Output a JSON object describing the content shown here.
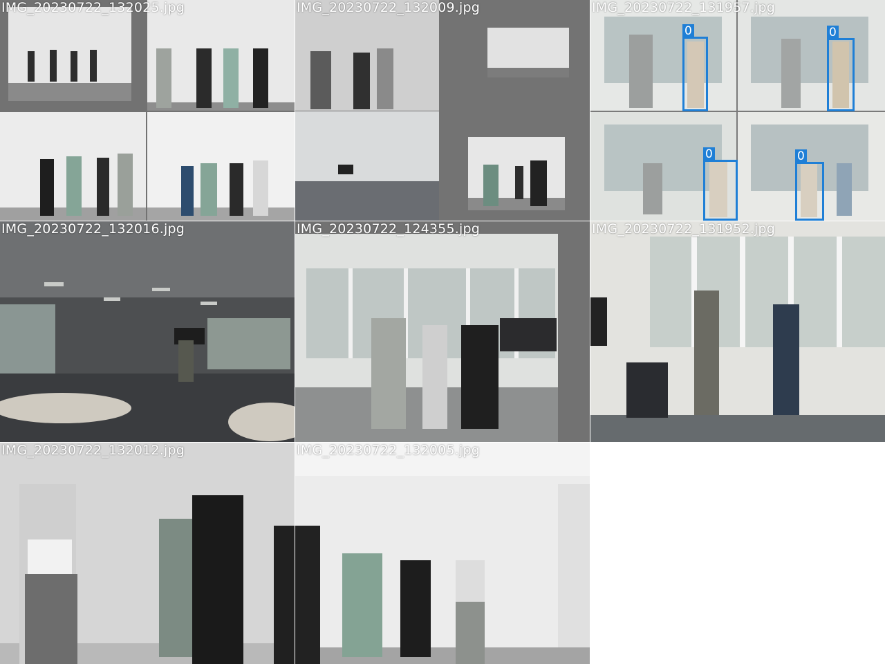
{
  "mosaic": {
    "tiles": [
      {
        "filename": "IMG_20230722_132025.jpg"
      },
      {
        "filename": "IMG_20230722_132009.jpg"
      },
      {
        "filename": "IMG_20230722_131957.jpg"
      },
      {
        "filename": "IMG_20230722_132016.jpg"
      },
      {
        "filename": "IMG_20230722_124355.jpg"
      },
      {
        "filename": "IMG_20230722_131952.jpg"
      },
      {
        "filename": "IMG_20230722_132012.jpg"
      },
      {
        "filename": "IMG_20230722_132005.jpg"
      }
    ],
    "detection_class_label": "0"
  },
  "colors": {
    "padding_gray": "#727272",
    "bbox_blue": "#1f7fd6",
    "label_text": "#ffffff"
  }
}
